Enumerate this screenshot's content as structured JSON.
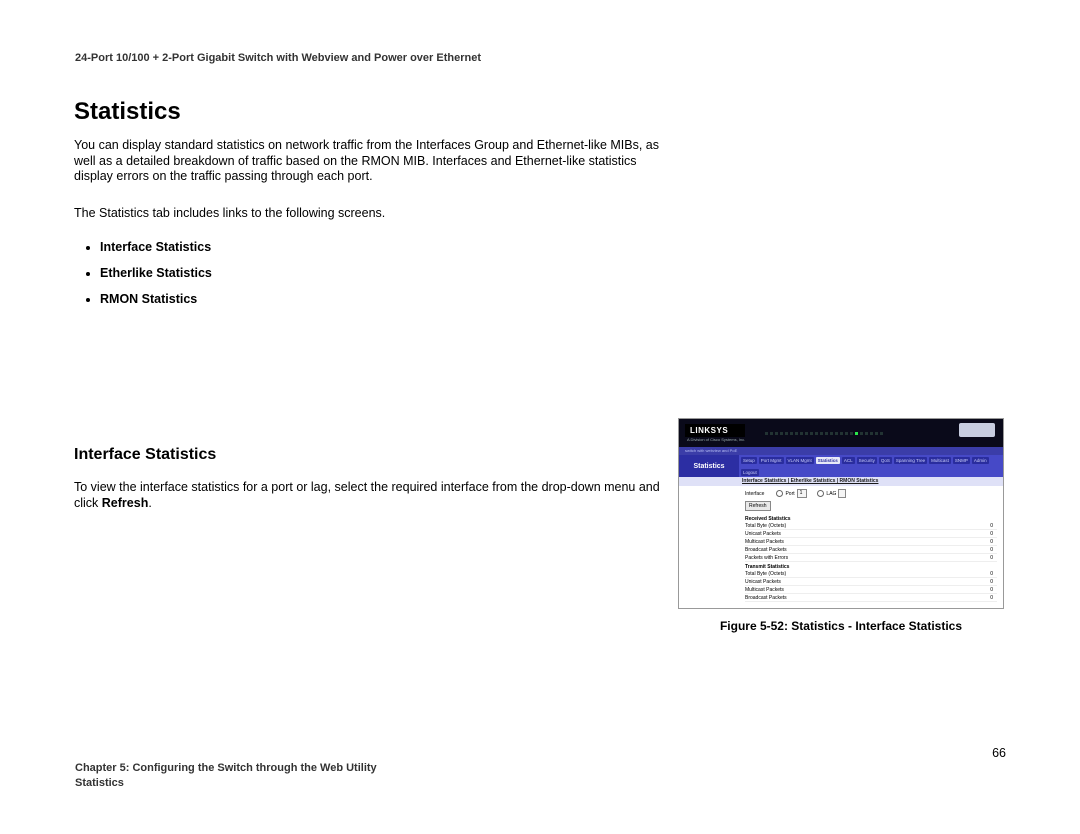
{
  "header": "24-Port 10/100 + 2-Port Gigabit Switch with Webview and Power over Ethernet",
  "statistics_heading": "Statistics",
  "para_intro": "You can display standard statistics on network traffic from the Interfaces Group and Ethernet-like MIBs, as well as a detailed breakdown of traffic based on the RMON MIB. Interfaces and Ethernet-like statistics display errors on the traffic passing through each port.",
  "para_tabdesc": "The Statistics tab includes links to the following screens.",
  "bullets": [
    "Interface Statistics",
    "Etherlike Statistics",
    "RMON Statistics"
  ],
  "subsection_heading": "Interface Statistics",
  "para_interface_pre": "To view the interface statistics for a port or lag, select the required interface from the drop-down menu and click ",
  "para_interface_bold": "Refresh",
  "para_interface_post": ".",
  "figure": {
    "caption": "Figure 5-52: Statistics - Interface Statistics",
    "logo": "LINKSYS",
    "logo_sub": "A Division of Cisco Systems, Inc.",
    "switch_line": "switch with webview and PoE",
    "side_label": "Statistics",
    "tabs": [
      "Setup",
      "Port Mgmt",
      "VLAN Mgmt",
      "Statistics",
      "ACL",
      "Security",
      "QoS",
      "Spanning Tree",
      "Multicast",
      "SNMP",
      "Admin",
      "Logout"
    ],
    "active_tab_index": 3,
    "subtabs_text_prefix": "",
    "subtabs_html": "Interface Statistics | Etherlike Statistics | RMON Statistics",
    "interface_label": "Interface",
    "port_radio_label": "Port",
    "port_value": "1",
    "lag_radio_label": "LAG",
    "refresh_btn": "Refresh",
    "recv_section": "Received Statistics",
    "tx_section": "Transmit Statistics",
    "rows_recv": [
      {
        "label": "Total Byte (Octets)",
        "value": "0"
      },
      {
        "label": "Unicast Packets",
        "value": "0"
      },
      {
        "label": "Multicast Packets",
        "value": "0"
      },
      {
        "label": "Broadcast Packets",
        "value": "0"
      },
      {
        "label": "Packets with Errors",
        "value": "0"
      }
    ],
    "rows_tx": [
      {
        "label": "Total Byte (Octets)",
        "value": "0"
      },
      {
        "label": "Unicast Packets",
        "value": "0"
      },
      {
        "label": "Multicast Packets",
        "value": "0"
      },
      {
        "label": "Broadcast Packets",
        "value": "0"
      }
    ]
  },
  "page_number": "66",
  "footer_line1": "Chapter 5: Configuring the Switch through the Web Utility",
  "footer_line2": "Statistics"
}
